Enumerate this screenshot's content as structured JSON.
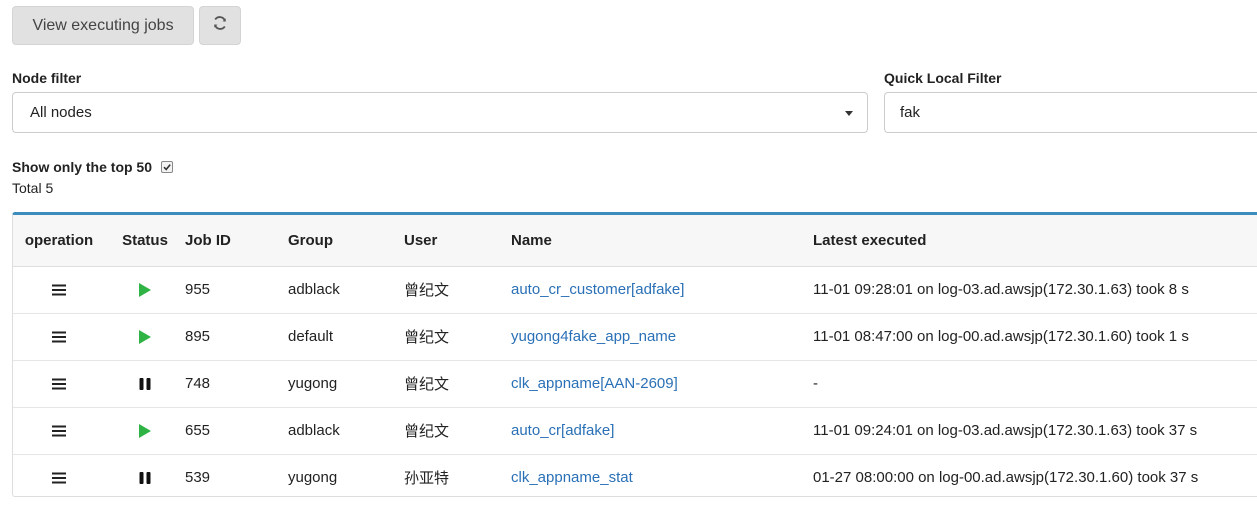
{
  "toolbar": {
    "view_executing_label": "View executing jobs",
    "refresh_icon": "refresh-icon"
  },
  "filters": {
    "node_filter_label": "Node filter",
    "node_filter_value": "All nodes",
    "quick_filter_label": "Quick Local Filter",
    "quick_filter_value": "fak"
  },
  "summary": {
    "show_top_label": "Show only the top 50",
    "show_top_checked": true,
    "total_text": "Total 5"
  },
  "table": {
    "headers": {
      "operation": "operation",
      "status": "Status",
      "job_id": "Job ID",
      "group": "Group",
      "user": "User",
      "name": "Name",
      "latest": "Latest executed"
    },
    "rows": [
      {
        "status": "running",
        "id": "955",
        "group": "adblack",
        "user": "曾纪文",
        "name": "auto_cr_customer[adfake]",
        "latest": "11-01 09:28:01 on log-03.ad.awsjp(172.30.1.63) took 8 s"
      },
      {
        "status": "running",
        "id": "895",
        "group": "default",
        "user": "曾纪文",
        "name": "yugong4fake_app_name",
        "latest": "11-01 08:47:00 on log-00.ad.awsjp(172.30.1.60) took 1 s"
      },
      {
        "status": "paused",
        "id": "748",
        "group": "yugong",
        "user": "曾纪文",
        "name": "clk_appname[AAN-2609]",
        "latest": "-"
      },
      {
        "status": "running",
        "id": "655",
        "group": "adblack",
        "user": "曾纪文",
        "name": "auto_cr[adfake]",
        "latest": "11-01 09:24:01 on log-03.ad.awsjp(172.30.1.63) took 37 s"
      },
      {
        "status": "paused",
        "id": "539",
        "group": "yugong",
        "user": "孙亚特",
        "name": "clk_appname_stat",
        "latest": "01-27 08:00:00 on log-00.ad.awsjp(172.30.1.60) took 37 s"
      }
    ]
  },
  "colors": {
    "accent": "#3c8dbc",
    "play": "#2fb344",
    "link": "#2a70b6"
  }
}
